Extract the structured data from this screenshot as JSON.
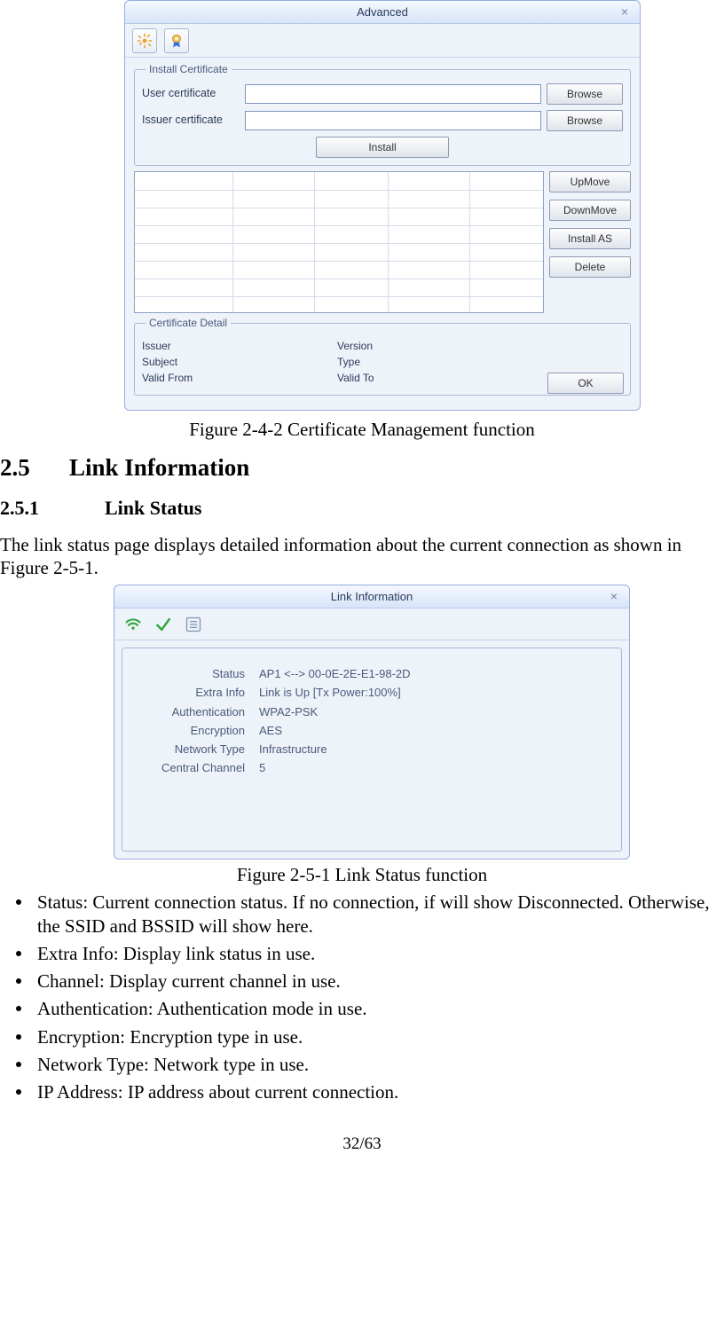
{
  "dlg1": {
    "title": "Advanced",
    "group_install": {
      "legend": "Install Certificate",
      "user_label": "User certificate",
      "issuer_label": "Issuer certificate",
      "browse": "Browse",
      "install": "Install"
    },
    "list_buttons": {
      "up": "UpMove",
      "down": "DownMove",
      "install_as": "Install AS",
      "delete": "Delete"
    },
    "details": {
      "legend": "Certificate Detail",
      "issuer": "Issuer",
      "version": "Version",
      "subject": "Subject",
      "type": "Type",
      "valid_from": "Valid From",
      "valid_to": "Valid To"
    },
    "ok": "OK"
  },
  "caption1": "Figure 2-4-2 Certificate Management function",
  "section": {
    "num": "2.5",
    "title": "Link Information"
  },
  "subsection": {
    "num": "2.5.1",
    "title": "Link Status"
  },
  "para1": "The link status page displays detailed information about the current connection as shown in Figure 2-5-1.",
  "dlg2": {
    "title": "Link Information",
    "rows": [
      {
        "label": "Status",
        "value": "AP1 <--> 00-0E-2E-E1-98-2D"
      },
      {
        "label": "Extra Info",
        "value": "Link is Up  [Tx Power:100%]"
      },
      {
        "label": "Authentication",
        "value": "WPA2-PSK"
      },
      {
        "label": "Encryption",
        "value": "AES"
      },
      {
        "label": "Network Type",
        "value": "Infrastructure"
      },
      {
        "label": "Central Channel",
        "value": "5"
      }
    ]
  },
  "caption2": "Figure 2-5-1 Link Status function",
  "bullets": [
    "Status: Current connection status. If no connection, if will show Disconnected. Otherwise, the SSID and BSSID will show here.",
    "Extra Info: Display link status in use.",
    "Channel: Display current channel in use.",
    "Authentication: Authentication mode in use.",
    "Encryption: Encryption type in use.",
    "Network Type: Network type in use.",
    "IP Address: IP address about current connection."
  ],
  "pagenum": "32/63"
}
